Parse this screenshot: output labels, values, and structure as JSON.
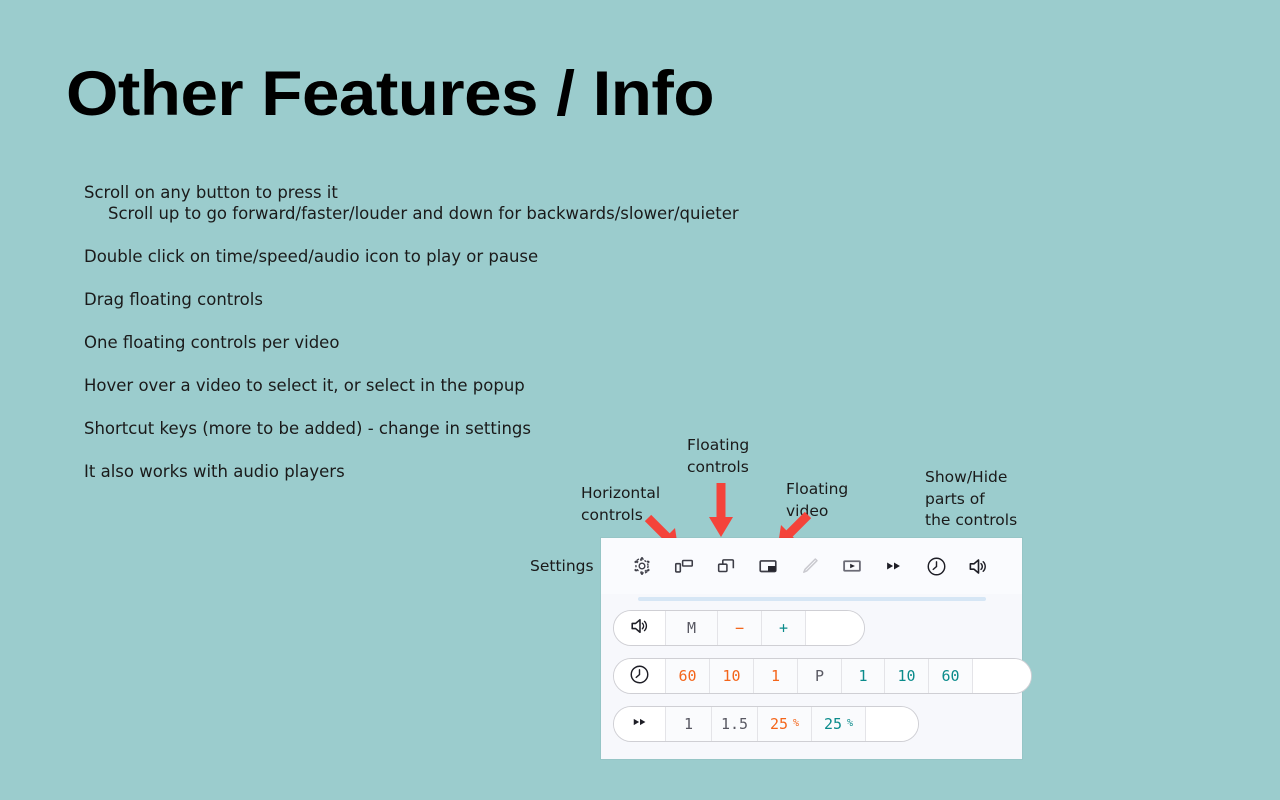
{
  "theme": {
    "background": "#9bcccd",
    "panel_bg": "#f7f8fc",
    "toolbar_bg": "#fafbfe",
    "arrow_red": "#f4433a",
    "orange": "#f4651a",
    "teal": "#0a8b8b",
    "grey": "#585862",
    "progress_track": "#d6e6f5"
  },
  "title": "Other Features / Info",
  "features": [
    {
      "text": "Scroll on any button to press it",
      "indent": false
    },
    {
      "text": "Scroll up to go forward/faster/louder and down for backwards/slower/quieter",
      "indent": true
    },
    {
      "text": "Double click on time/speed/audio icon to play or pause",
      "indent": false
    },
    {
      "text": "Drag floating controls",
      "indent": false
    },
    {
      "text": "One floating controls per video",
      "indent": false
    },
    {
      "text": "Hover over a video to select it, or select in the popup",
      "indent": false
    },
    {
      "text": "Shortcut keys (more to be added) - change in settings",
      "indent": false
    },
    {
      "text": "It also works with audio players",
      "indent": false
    }
  ],
  "annotations": {
    "settings": "Settings",
    "horizontal_controls": "Horizontal\ncontrols",
    "floating_controls": "Floating\ncontrols",
    "floating_video": "Floating\nvideo",
    "show_hide": "Show/Hide\nparts of\nthe controls"
  },
  "toolbar": {
    "buttons": [
      {
        "icon": "gear-icon",
        "name": "settings-button",
        "disabled": false
      },
      {
        "icon": "horizontal-controls-icon",
        "name": "horizontal-controls-button",
        "disabled": false
      },
      {
        "icon": "floating-controls-icon",
        "name": "floating-controls-button",
        "disabled": false
      },
      {
        "icon": "picture-in-picture-icon",
        "name": "floating-video-button",
        "disabled": false
      },
      {
        "icon": "pencil-icon",
        "name": "edit-button",
        "disabled": true
      },
      {
        "icon": "video-frame-icon",
        "name": "video-toggle-button",
        "disabled": false
      },
      {
        "icon": "fast-forward-icon",
        "name": "speed-toggle-button",
        "disabled": false
      },
      {
        "icon": "clock-icon",
        "name": "time-toggle-button",
        "disabled": false
      },
      {
        "icon": "speaker-icon",
        "name": "audio-toggle-button",
        "disabled": false
      }
    ]
  },
  "progress": {
    "value_percent": 0
  },
  "rows": {
    "audio": {
      "icon": "speaker-icon",
      "cells": [
        {
          "label": "M",
          "color": "grey",
          "width": 52
        },
        {
          "label": "−",
          "color": "orange",
          "width": 44
        },
        {
          "label": "+",
          "color": "teal",
          "width": 44
        },
        {
          "label": "",
          "color": "empty",
          "width": 58
        }
      ]
    },
    "time": {
      "icon": "clock-icon",
      "cells": [
        {
          "label": "60",
          "color": "orange",
          "width": 44
        },
        {
          "label": "10",
          "color": "orange",
          "width": 44
        },
        {
          "label": "1",
          "color": "orange",
          "width": 44
        },
        {
          "label": "P",
          "color": "grey",
          "width": 44
        },
        {
          "label": "1",
          "color": "teal",
          "width": 43
        },
        {
          "label": "10",
          "color": "teal",
          "width": 44
        },
        {
          "label": "60",
          "color": "teal",
          "width": 44
        },
        {
          "label": "",
          "color": "empty",
          "width": 58
        }
      ]
    },
    "speed": {
      "icon": "fast-forward-icon",
      "cells": [
        {
          "label": "1",
          "color": "grey",
          "width": 46
        },
        {
          "label": "1.5",
          "color": "grey",
          "width": 46
        },
        {
          "label": "25",
          "suffix": "%",
          "color": "orange",
          "width": 54
        },
        {
          "label": "25",
          "suffix": "%",
          "color": "teal",
          "width": 54
        },
        {
          "label": "",
          "color": "empty",
          "width": 52
        }
      ]
    }
  }
}
